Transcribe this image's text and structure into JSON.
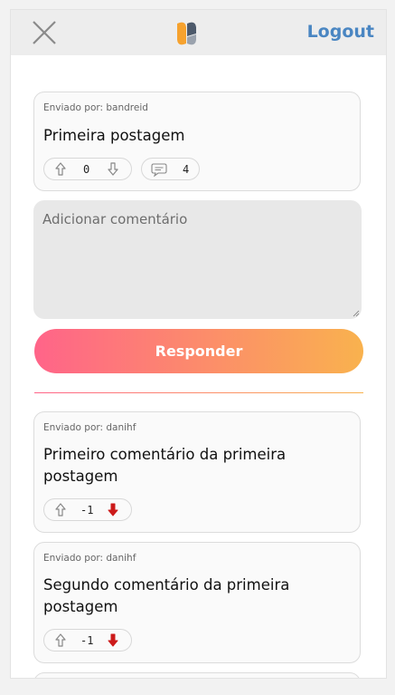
{
  "header": {
    "logout_label": "Logout"
  },
  "post": {
    "sender": "Enviado por: bandreid",
    "title": "Primeira postagem",
    "votes": "0",
    "comment_count": "4"
  },
  "comment_form": {
    "placeholder": "Adicionar comentário",
    "submit_label": "Responder"
  },
  "comments": [
    {
      "sender": "Enviado por: danihf",
      "text": "Primeiro comentário da primeira postagem",
      "votes": "-1"
    },
    {
      "sender": "Enviado por: danihf",
      "text": "Segundo comentário da primeira postagem",
      "votes": "-1"
    }
  ],
  "colors": {
    "accent": "#4a86c2",
    "gradient_start": "#ff6489",
    "gradient_end": "#f9b24e",
    "downvote_active": "#cc1a1a"
  }
}
